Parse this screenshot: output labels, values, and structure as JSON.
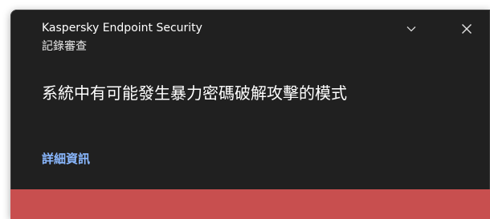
{
  "notification": {
    "app_name": "Kaspersky Endpoint Security",
    "category": "記錄審查",
    "message": "系統中有可能發生暴力密碼破解攻擊的模式",
    "details_link": "詳細資訊",
    "icons": {
      "expand": "chevron-down-icon",
      "close": "close-icon"
    },
    "colors": {
      "background": "#202020",
      "text": "#ffffff",
      "link": "#8ab8ff",
      "severity": "#c84f4f"
    }
  }
}
